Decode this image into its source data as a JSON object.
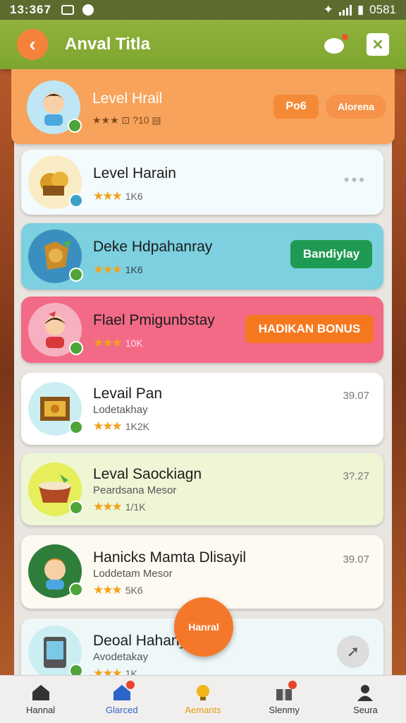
{
  "status_bar": {
    "time": "13:367",
    "battery": "0581"
  },
  "header": {
    "title": "Anval Titla"
  },
  "cards": [
    {
      "title": "Level Hrail",
      "meta": "★★★  ⊡  ?10  ▤",
      "pill_left": "Po6",
      "pill_right": "Alorena"
    },
    {
      "title": "Level Harain",
      "meta": "1K6"
    },
    {
      "title": "Deke Hdpahanray",
      "meta": "1K6",
      "badge": "Bandiylay"
    },
    {
      "title": "Flael Pmigunbstay",
      "meta": "10K",
      "badge": "HADIKAN BONUS"
    },
    {
      "title": "Levail Pan",
      "subtitle": "Lodetakhay",
      "meta": "1K2K",
      "time": "39.07"
    },
    {
      "title": "Leval Saockiagn",
      "subtitle": "Peardsana Mesor",
      "meta": "1/1K",
      "time": "3?.27"
    },
    {
      "title": "Hanicks Mamta Dlisayil",
      "subtitle": "Loddetam Mesor",
      "meta": "5K6",
      "time": "39.07"
    },
    {
      "title": "Deoal Hahany",
      "subtitle": "Avodetakay",
      "meta": "1K"
    }
  ],
  "fab": {
    "label": "Hanral"
  },
  "bottom_nav": [
    {
      "label": "Hannal",
      "icon": "home-icon"
    },
    {
      "label": "Glarced",
      "icon": "house-badge-icon"
    },
    {
      "label": "Aemants",
      "icon": "bulb-icon"
    },
    {
      "label": "Slenmy",
      "icon": "gift-icon"
    },
    {
      "label": "Seura",
      "icon": "user-icon"
    }
  ],
  "colors": {
    "header": "#7ea62f",
    "accent": "#f5823a",
    "card_orange": "#f7a35c",
    "card_teal": "#7cd0df",
    "card_pink": "#f36a86",
    "card_green": "#eef6d6"
  }
}
